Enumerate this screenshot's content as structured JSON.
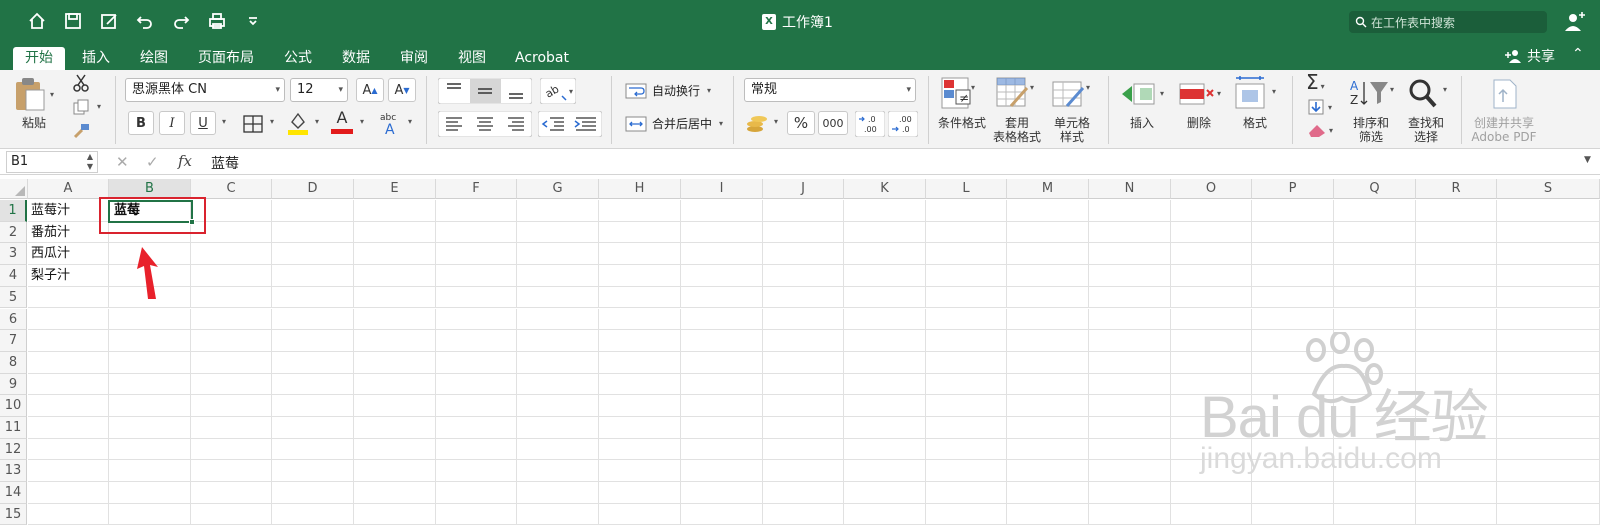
{
  "titlebar": {
    "document_title": "工作簿1",
    "search_placeholder": "在工作表中搜索",
    "qat_icons": [
      "home-icon",
      "save-icon",
      "edit-icon",
      "undo-icon",
      "redo-icon",
      "print-icon",
      "more-icon"
    ]
  },
  "tabs": [
    {
      "label": "开始",
      "active": true
    },
    {
      "label": "插入"
    },
    {
      "label": "绘图"
    },
    {
      "label": "页面布局"
    },
    {
      "label": "公式"
    },
    {
      "label": "数据"
    },
    {
      "label": "审阅"
    },
    {
      "label": "视图"
    },
    {
      "label": "Acrobat"
    }
  ],
  "share_label": "共享",
  "ribbon": {
    "paste_label": "粘贴",
    "font_name": "思源黑体 CN",
    "font_size": "12",
    "bold": "B",
    "italic": "I",
    "underline": "U",
    "font_color_glyph": "A",
    "wrap_text": "自动换行",
    "merge_center": "合并后居中",
    "number_format": "常规",
    "percent": "%",
    "thousands": "000",
    "conditional_format": "条件格式",
    "table_format": [
      "套用",
      "表格格式"
    ],
    "cell_style": [
      "单元格",
      "样式"
    ],
    "insert": "插入",
    "delete": "删除",
    "format": "格式",
    "sort_filter": [
      "排序和",
      "筛选"
    ],
    "find_select": [
      "查找和",
      "选择"
    ],
    "adobe_pdf": [
      "创建并共享",
      "Adobe PDF"
    ],
    "accent": "#217346"
  },
  "formula_bar": {
    "name_box": "B1",
    "fx_label": "fx",
    "value": "蓝莓"
  },
  "sheet": {
    "columns": [
      "A",
      "B",
      "C",
      "D",
      "E",
      "F",
      "G",
      "H",
      "I",
      "J",
      "K",
      "L",
      "M",
      "N",
      "O",
      "P",
      "Q",
      "R",
      "S"
    ],
    "rows": [
      "1",
      "2",
      "3",
      "4",
      "5",
      "6",
      "7",
      "8",
      "9",
      "10",
      "11",
      "12",
      "13",
      "14",
      "15"
    ],
    "cells": {
      "A1": "蓝莓汁",
      "A2": "番茄汁",
      "A3": "西瓜汁",
      "A4": "梨子汁",
      "B1": "蓝莓"
    },
    "selected": "B1"
  },
  "watermark": {
    "main": "Bai du 经验",
    "sub": "jingyan.baidu.com"
  }
}
